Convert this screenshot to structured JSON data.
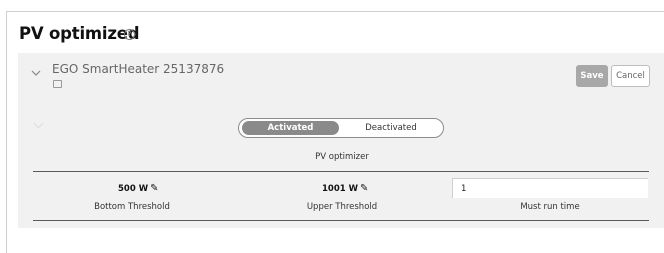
{
  "page": {
    "title": "PV optimized",
    "help_icon": "help-circle-icon"
  },
  "device": {
    "name": "EGO SmartHeater 25137876",
    "icon": "device-icon",
    "expand_icon": "chevron-down-icon"
  },
  "actions": {
    "save_label": "Save",
    "cancel_label": "Cancel"
  },
  "toggle": {
    "on_label": "Activated",
    "off_label": "Deactivated",
    "selected": "Activated",
    "caption": "PV optimizer"
  },
  "settings": {
    "bottom_threshold": {
      "value": "500 W",
      "label": "Bottom Threshold",
      "edit_icon": "pencil-icon"
    },
    "upper_threshold": {
      "value": "1001 W",
      "label": "Upper Threshold",
      "edit_icon": "pencil-icon"
    },
    "must_run_time": {
      "value": "1",
      "label": "Must run time"
    }
  },
  "colors": {
    "panel_bg": "#f1f1f1",
    "save_bg": "#a8a8a8",
    "toggle_active_bg": "#8a8a8a"
  }
}
